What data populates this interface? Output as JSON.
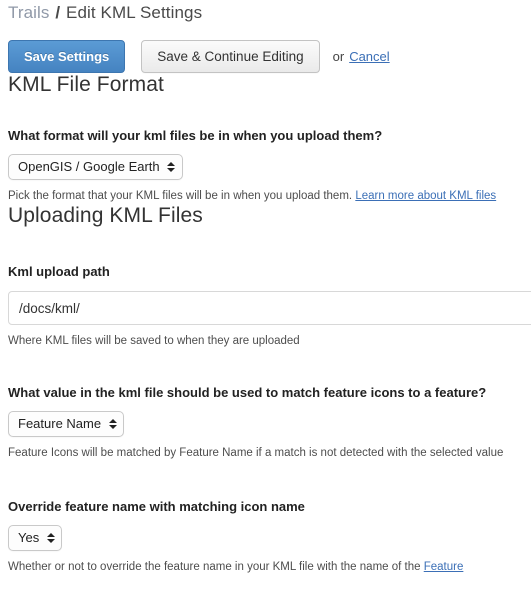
{
  "breadcrumb": {
    "parent": "Trails",
    "separator": "/",
    "current": "Edit KML Settings"
  },
  "toolbar": {
    "save_label": "Save Settings",
    "save_continue_label": "Save & Continue Editing",
    "or_label": "or",
    "cancel_label": "Cancel"
  },
  "sections": {
    "kml_file_format": {
      "title": "KML File Format",
      "format_question": {
        "label": "What format will your kml files be in when you upload them?",
        "selected": "OpenGIS / Google Earth",
        "help_text": "Pick the format that your KML files will be in when you upload them.",
        "help_link": "Learn more about KML files"
      }
    },
    "uploading_kml_files": {
      "title": "Uploading KML Files",
      "upload_path": {
        "label": "Kml upload path",
        "value": "/docs/kml/",
        "placeholder": "",
        "help_text": "Where KML files will be saved to when they are uploaded"
      },
      "match_value": {
        "label": "What value in the kml file should be used to match feature icons to a feature?",
        "selected": "Feature Name",
        "help_text": "Feature Icons will be matched by Feature Name if a match is not detected with the selected value"
      },
      "override_name": {
        "label": "Override feature name with matching icon name",
        "selected": "Yes",
        "help_text": "Whether or not to override the feature name in your KML file with the name of the",
        "help_link": "Feature"
      }
    }
  },
  "colors": {
    "primary_button": "#4e8cc8",
    "link": "#3b6fb6",
    "breadcrumb_parent": "#9099a8",
    "text": "#333333"
  }
}
